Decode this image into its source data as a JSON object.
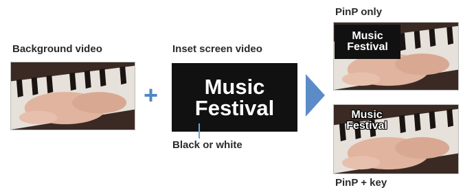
{
  "background": {
    "label": "Background video"
  },
  "inset": {
    "label": "Inset screen video",
    "title_line1": "Music",
    "title_line2": "Festival",
    "color_note": "Black or white"
  },
  "operator": "+",
  "results": {
    "pinp_only": {
      "label": "PinP only",
      "line1": "Music",
      "line2": "Festival"
    },
    "pinp_key": {
      "label": "PinP + key",
      "line1": "Music",
      "line2": "Festival"
    }
  },
  "colors": {
    "accent": "#4f86c6",
    "arrow": "#5b8cc8",
    "inset_bg": "#111111"
  }
}
